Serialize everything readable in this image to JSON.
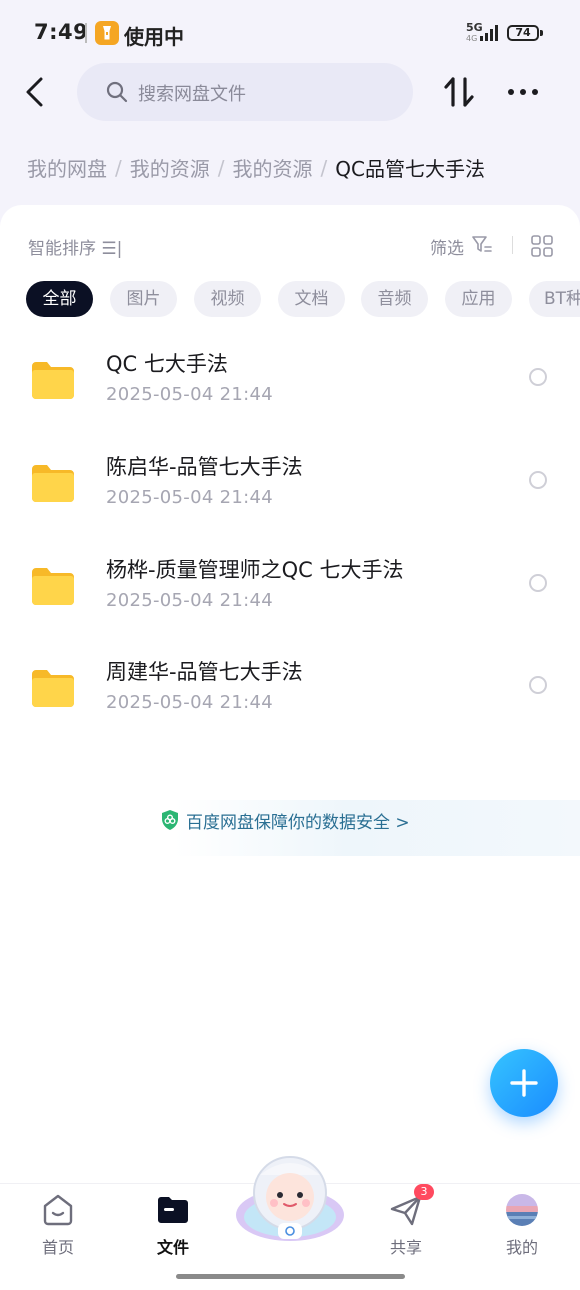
{
  "status_bar": {
    "time": "7:49",
    "app_status": "使用中",
    "network": "5G",
    "network_sub": "4G",
    "battery": "74"
  },
  "header": {
    "search_placeholder": "搜索网盘文件",
    "back_icon": "chevron-left-icon",
    "sort_icon": "sort-arrows-icon",
    "more_icon": "more-dots-icon"
  },
  "breadcrumb": {
    "items": [
      "我的网盘",
      "我的资源",
      "我的资源"
    ],
    "current": "QC品管七大手法"
  },
  "toolbar": {
    "sort_label": "智能排序 ☰|",
    "filter_label": "筛选"
  },
  "categories": [
    "全部",
    "图片",
    "视频",
    "文档",
    "音频",
    "应用",
    "BT种子"
  ],
  "files": [
    {
      "name": "QC 七大手法",
      "date": "2025-05-04  21:44"
    },
    {
      "name": "陈启华-品管七大手法",
      "date": "2025-05-04  21:44"
    },
    {
      "name": "杨桦-质量管理师之QC 七大手法",
      "date": "2025-05-04  21:44"
    },
    {
      "name": "周建华-品管七大手法",
      "date": "2025-05-04  21:44"
    }
  ],
  "security_banner": "百度网盘保障你的数据安全 >",
  "bottom_nav": {
    "home": "首页",
    "files": "文件",
    "share": "共享",
    "share_badge": "3",
    "me": "我的"
  },
  "colors": {
    "accent": "#1a8cff",
    "folder": "#ffc933",
    "chip_active": "#0b1024",
    "badge": "#ff4a5f"
  }
}
